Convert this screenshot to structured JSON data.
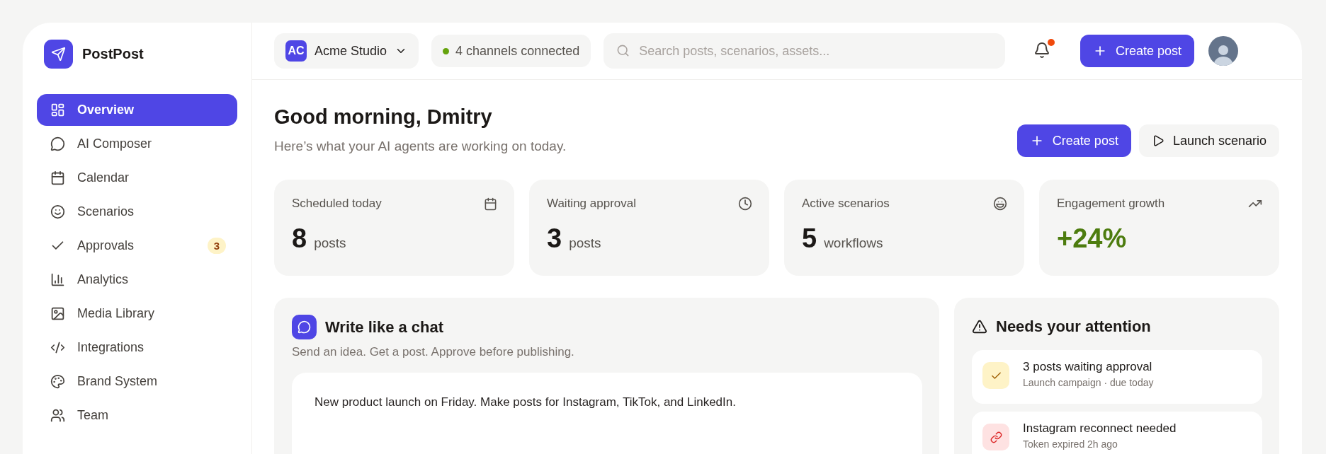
{
  "brand": {
    "name": "PostPost"
  },
  "sidebar": {
    "items": [
      {
        "label": "Overview",
        "selected": true
      },
      {
        "label": "AI Composer",
        "selected": false
      },
      {
        "label": "Calendar",
        "selected": false
      },
      {
        "label": "Scenarios",
        "selected": false
      },
      {
        "label": "Approvals",
        "selected": false,
        "badge": "3"
      },
      {
        "label": "Analytics",
        "selected": false
      },
      {
        "label": "Media Library",
        "selected": false
      },
      {
        "label": "Integrations",
        "selected": false
      },
      {
        "label": "Brand System",
        "selected": false
      },
      {
        "label": "Team",
        "selected": false
      }
    ]
  },
  "topbar": {
    "workspace": {
      "initials": "AC",
      "name": "Acme Studio"
    },
    "channels": "4 channels connected",
    "search": {
      "placeholder": "Search posts, scenarios, assets..."
    },
    "notifications": {
      "unread": true
    },
    "create_button": "Create post"
  },
  "greeting": {
    "title": "Good morning, Dmitry",
    "subtitle": "Here’s what your AI agents are working on today.",
    "actions": [
      {
        "label": "Create post",
        "kind": "primary"
      },
      {
        "label": "Launch scenario",
        "kind": "secondary"
      }
    ]
  },
  "stats": [
    {
      "label": "Scheduled today",
      "value": "8",
      "unit": "posts",
      "kind": "calendar"
    },
    {
      "label": "Waiting approval",
      "value": "3",
      "unit": "posts",
      "kind": "clock"
    },
    {
      "label": "Active scenarios",
      "value": "5",
      "unit": "workflows",
      "kind": "scenario"
    },
    {
      "label": "Engagement growth",
      "value": "+24%",
      "kind": "growth"
    }
  ],
  "composer": {
    "title": "Write like a chat",
    "subtitle": "Send an idea. Get a post. Approve before publishing.",
    "prompt": "New product launch on Friday. Make posts for Instagram, TikTok, and LinkedIn."
  },
  "attention": {
    "title": "Needs your attention",
    "items": [
      {
        "title": "3 posts waiting approval",
        "detail": "Launch campaign · due today",
        "kind": "approval"
      },
      {
        "title": "Instagram reconnect needed",
        "detail": "Token expired 2h ago",
        "kind": "error"
      }
    ]
  }
}
